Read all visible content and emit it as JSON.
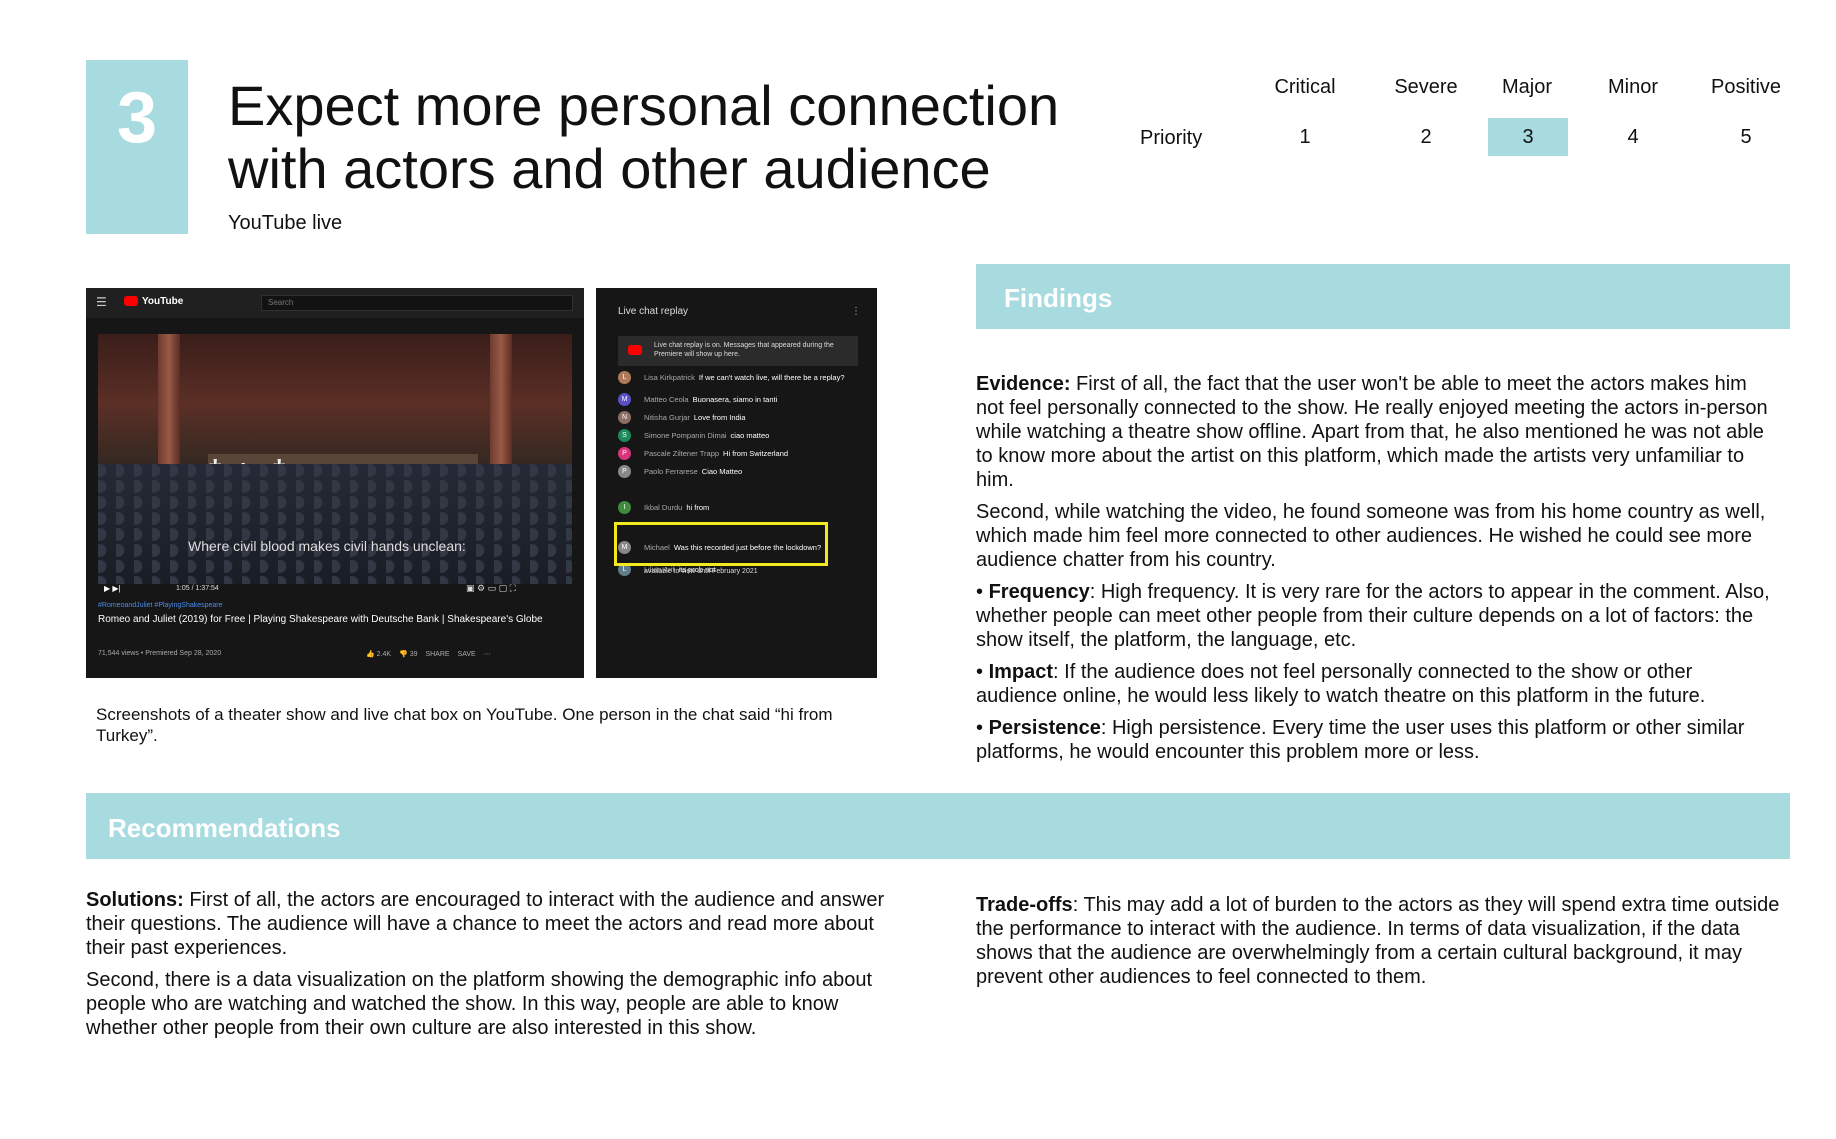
{
  "header": {
    "number": "3",
    "title": "Expect more personal connection with actors and other audience",
    "subtitle": "YouTube live"
  },
  "priority": {
    "label": "Priority",
    "levels": [
      {
        "name": "Critical",
        "value": "1"
      },
      {
        "name": "Severe",
        "value": "2"
      },
      {
        "name": "Major",
        "value": "3"
      },
      {
        "name": "Minor",
        "value": "4"
      },
      {
        "name": "Positive",
        "value": "5"
      }
    ],
    "selected": "3",
    "highlight_color": "#a8dbe0"
  },
  "screenshot": {
    "logo": "YouTube",
    "search_placeholder": "Search",
    "subtitle_caption": "Where civil blood makes civil hands unclean:",
    "time": "1:05 / 1:37:54",
    "progress": 0.01,
    "tags": "#RomeoandJuliet #PlayingShakespeare",
    "video_title": "Romeo and Juliet (2019) for Free | Playing Shakespeare with Deutsche Bank | Shakespeare's Globe",
    "meta": "71,544 views • Premiered Sep 28, 2020",
    "likes": "2.4K",
    "dislikes": "39",
    "share": "SHARE",
    "save": "SAVE",
    "chat_title": "Live chat replay",
    "chat_notice": "Live chat replay is on. Messages that appeared during the Premiere will show up here.",
    "chat": [
      {
        "initial": "L",
        "color": "#b07a5a",
        "name": "Lisa Kirkpatrick",
        "msg": "If we can't watch live, will there be a replay?"
      },
      {
        "initial": "M",
        "color": "#5b4fc7",
        "name": "Matteo Ceola",
        "msg": "Buonasera, siamo in tanti"
      },
      {
        "initial": "N",
        "color": "#8d6e63",
        "name": "Nitisha Gurjar",
        "msg": "Love from India"
      },
      {
        "initial": "S",
        "color": "#1e8a5a",
        "name": "Simone Pompanin Dimai",
        "msg": "ciao matteo"
      },
      {
        "initial": "P",
        "color": "#d8357a",
        "name": "Pascale Ziltener Trapp",
        "msg": "Hi from Switzerland"
      },
      {
        "initial": "P",
        "color": "#888888",
        "name": "Paolo Ferrarese",
        "msg": "Ciao Matteo"
      },
      {
        "initial": "I",
        "color": "#3f8c3f",
        "name": "Ikbal Durdu",
        "msg": "hi from"
      },
      {
        "initial": "M",
        "color": "#888888",
        "name": "Michael",
        "msg": "Was this recorded just before the lockdown?"
      },
      {
        "initial": "L",
        "color": "#607d8b",
        "name": "Lilian Arif",
        "msg": "its prob not"
      }
    ],
    "chat_pinned": "available to view until February 2021",
    "highlight_color": "#f2ea1c"
  },
  "figure_caption": "Screenshots of a theater show and live chat box on YouTube. One person in the chat said “hi from Turkey”.",
  "findings": {
    "heading": "Findings",
    "evidence_label": "Evidence:",
    "evidence_1": " First of all, the fact that the user won't be able to meet the actors makes him not feel personally connected to the show. He really enjoyed meeting the actors in-person while watching a theatre show offline. Apart from that, he also mentioned he was not able to know more about the artist on this platform, which made the artists very unfamiliar to him.",
    "evidence_2": "Second, while watching the video, he found someone was from his home country as well, which made him feel more connected to other audiences. He wished he could see more audience chatter from his country.",
    "frequency_label": "Frequency",
    "frequency_text": ": High frequency. It is very rare for the actors to appear in the comment. Also, whether people can meet other people from their culture depends on a lot of factors: the show itself, the platform, the language, etc.",
    "impact_label": "Impact",
    "impact_text": ": If the audience does not feel personally connected to the show or other audience online, he would less likely to watch theatre on this platform in the future.",
    "persistence_label": "Persistence",
    "persistence_text": ": High persistence. Every time the user uses this platform or other similar platforms, he would encounter this problem more or less."
  },
  "recommendations": {
    "heading": "Recommendations",
    "solutions_label": "Solutions:",
    "solutions_1": " First of all, the actors are encouraged to interact with the audience and answer their questions. The audience will have a chance to meet the actors and read more about their past experiences.",
    "solutions_2": "Second, there is a data visualization on the platform showing the demographic info about people who are watching and watched the show. In this way, people are able to know whether other people from their own culture are also interested in this show.",
    "tradeoffs_label": "Trade-offs",
    "tradeoffs_text": ": This may add a lot of burden to the actors as they will spend extra time outside the performance to interact with the audience. In terms of data visualization, if the data shows that the audience are overwhelmingly from a certain cultural background, it may prevent other audiences to feel connected to them."
  },
  "colors": {
    "accent": "#a8dbe0",
    "youtube_bg": "#161616"
  }
}
